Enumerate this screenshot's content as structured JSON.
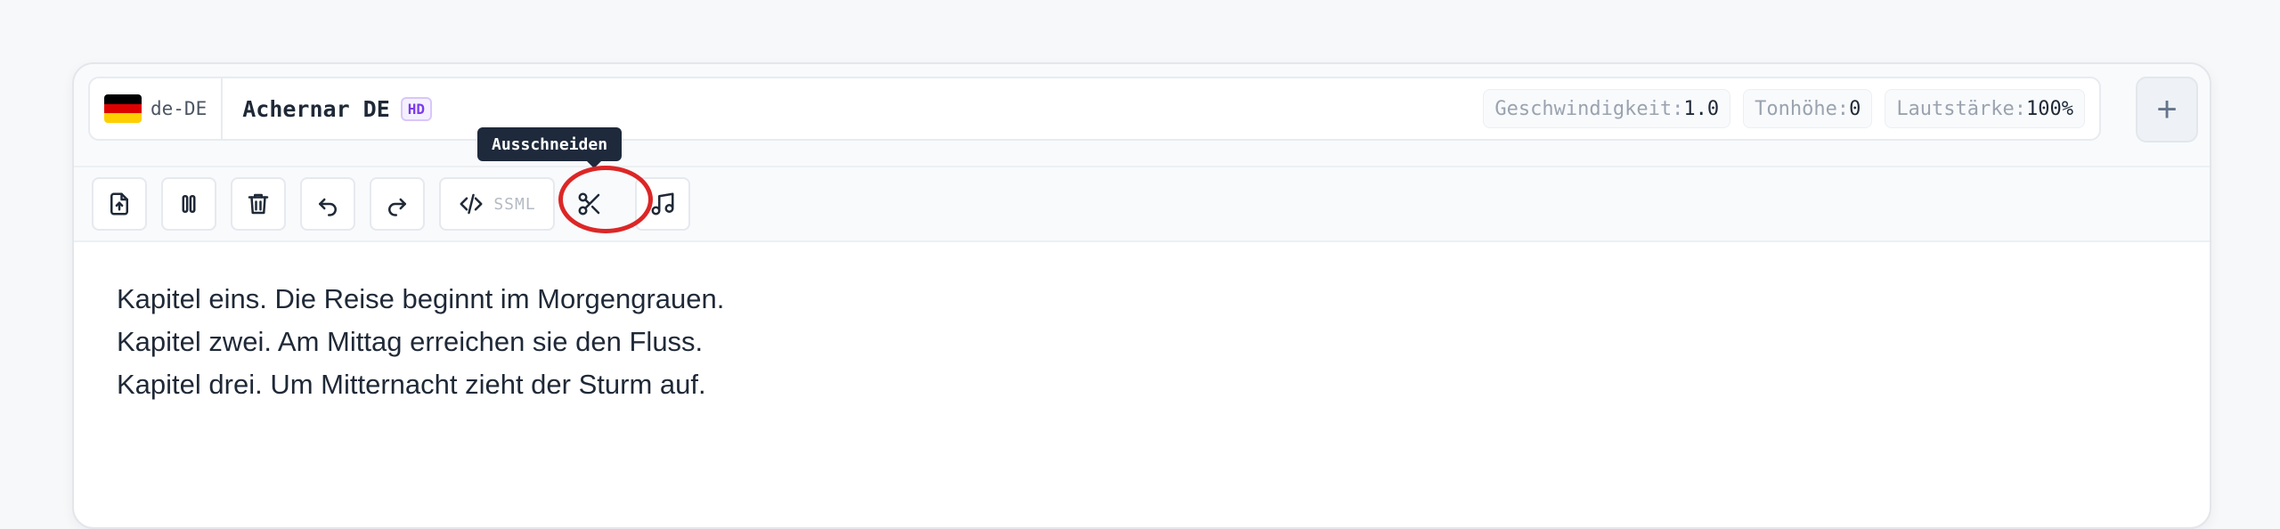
{
  "voice": {
    "locale": "de-DE",
    "flag_colors": [
      "#000000",
      "#dd0000",
      "#ffce00"
    ],
    "name": "Achernar DE",
    "badge": "HD"
  },
  "params": [
    {
      "label": "Geschwindigkeit:",
      "value": "1.0"
    },
    {
      "label": "Tonhöhe:",
      "value": "0"
    },
    {
      "label": "Lautstärke:",
      "value": "100%"
    }
  ],
  "add_button_label": "+",
  "toolbar": {
    "buttons": [
      "upload-icon",
      "pause-icon",
      "trash-icon",
      "undo-icon",
      "redo-icon",
      "code-icon",
      "scissors-icon",
      "music-icon"
    ],
    "ssml_label": "SSML",
    "tooltip": "Ausschneiden"
  },
  "editor": {
    "lines": [
      "Kapitel eins. Die Reise beginnt im Morgengrauen.",
      "Kapitel zwei. Am Mittag erreichen sie den Fluss.",
      "Kapitel drei. Um Mitternacht zieht der Sturm auf."
    ]
  },
  "colors": {
    "highlight": "#dc2626",
    "badge_accent": "#7c3aed",
    "tooltip_bg": "#1e293b"
  }
}
